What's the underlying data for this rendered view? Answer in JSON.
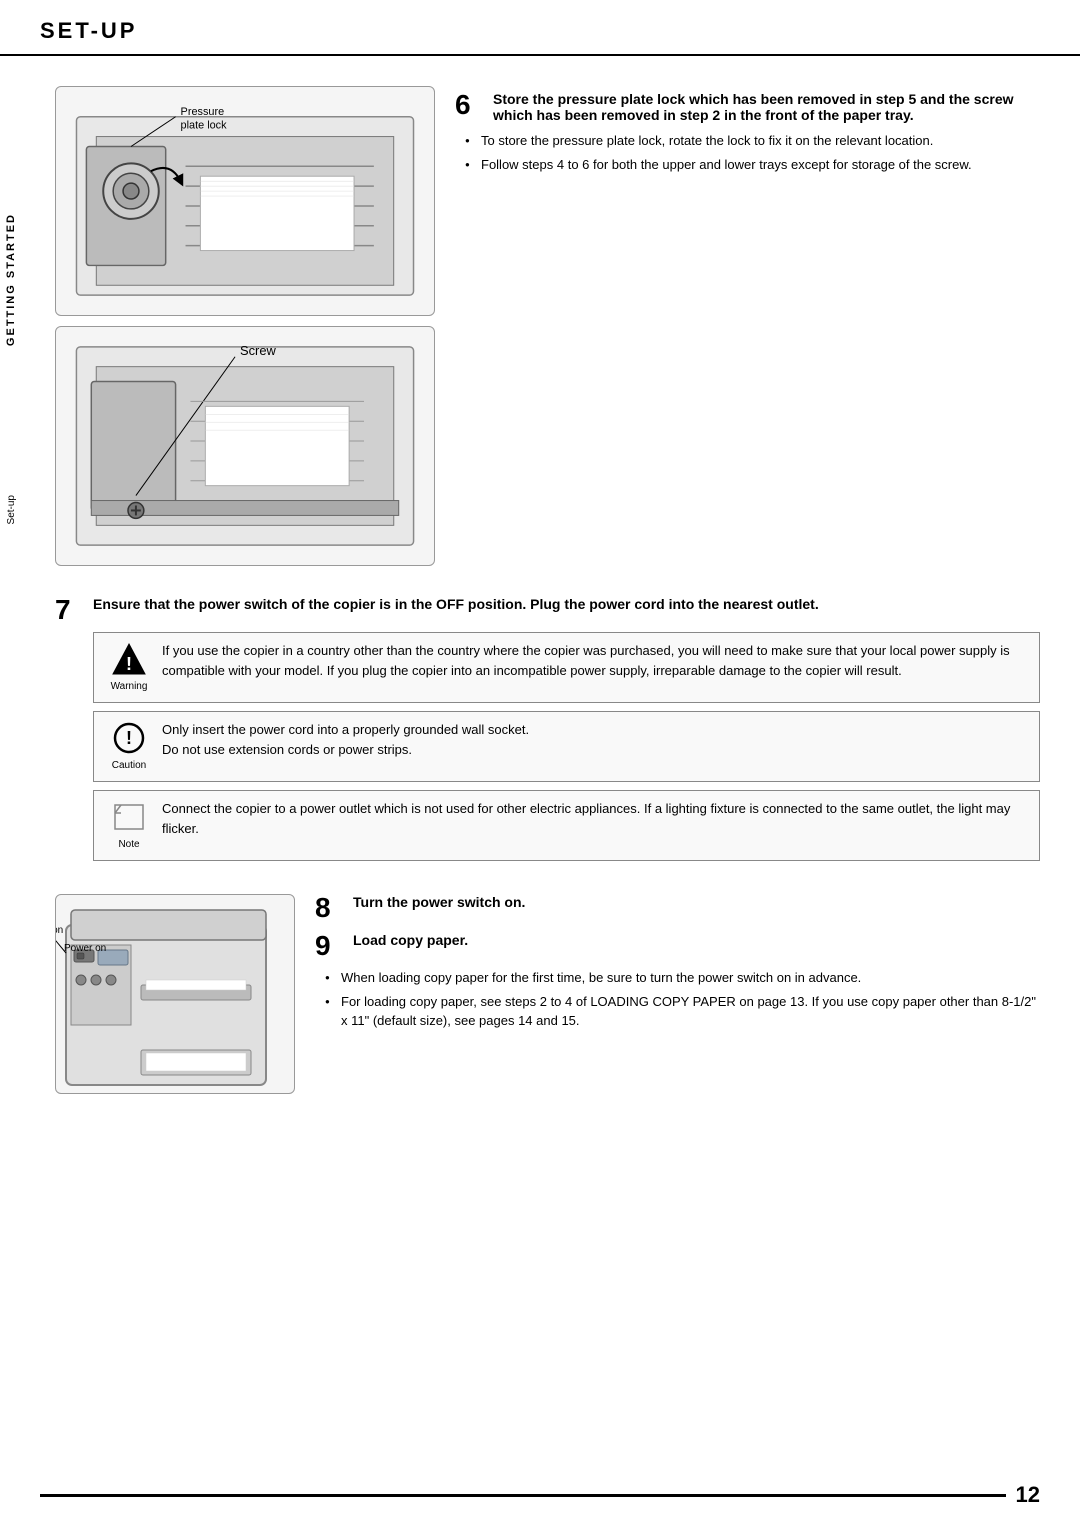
{
  "header": {
    "title": "SET-UP"
  },
  "sideLabels": {
    "gettingStarted": "GETTING STARTED",
    "setupText": "Set-up"
  },
  "step6": {
    "number": "6",
    "instruction": "Store the pressure plate lock which has been removed in step 5 and the screw which has been removed in step 2 in the front of the paper tray.",
    "bullets": [
      "To store the pressure plate lock, rotate the lock to fix it on the relevant location.",
      "Follow steps 4 to 6 for both the upper and lower trays except for storage of the screw."
    ],
    "illustration1": {
      "label": "Pressure plate lock"
    },
    "illustration2": {
      "label": "Screw"
    }
  },
  "step7": {
    "number": "7",
    "instruction": "Ensure that the power switch of the copier is in the OFF position. Plug the power cord into the nearest outlet.",
    "warning": {
      "iconLabel": "Warning",
      "text": "If you use the copier in a country other than the country where the copier was purchased, you will need to make sure that your local power supply is compatible with your model. If you plug the copier into an incompatible power supply, irreparable damage to the copier will result."
    },
    "caution": {
      "iconLabel": "Caution",
      "text1": "Only insert the power cord into a properly grounded wall socket.",
      "text2": "Do not use extension cords or power strips."
    },
    "note": {
      "iconLabel": "Note",
      "text": "Connect the copier to a power outlet which is not used for other electric appliances. If a lighting fixture is connected to the same outlet, the light may flicker."
    }
  },
  "step8": {
    "number": "8",
    "instruction": "Turn the power switch on.",
    "illustration": {
      "label": "Power on"
    }
  },
  "step9": {
    "number": "9",
    "instruction": "Load copy paper.",
    "bullets": [
      "When loading copy paper for the first time, be sure to turn the power switch on in advance.",
      "For loading copy paper, see steps 2 to 4 of LOADING COPY PAPER on page 13. If you use copy paper other than 8-1/2\" x 11\" (default size), see pages 14 and 15."
    ]
  },
  "footer": {
    "pageNumber": "12"
  }
}
